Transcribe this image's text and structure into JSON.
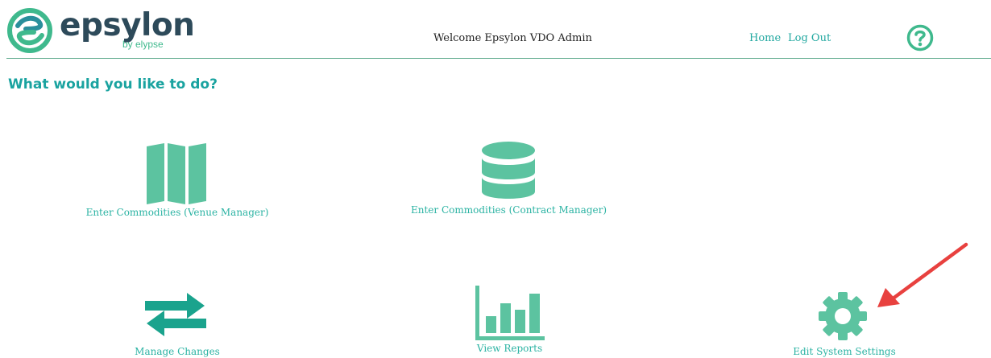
{
  "header": {
    "logo_text": "epsylon",
    "logo_sub": "by elypse",
    "welcome": "Welcome Epsylon VDO Admin",
    "nav": {
      "home": "Home",
      "logout": "Log Out"
    },
    "help_icon": "question-circle-icon"
  },
  "page": {
    "title": "What would you like to do?"
  },
  "tiles": [
    {
      "label": "Enter Commodities (Venue Manager)",
      "icon": "map-icon"
    },
    {
      "label": "Enter Commodities (Contract Manager)",
      "icon": "database-icon"
    },
    {
      "label": "Manage Changes",
      "icon": "exchange-arrows-icon"
    },
    {
      "label": "View Reports",
      "icon": "bar-chart-icon"
    },
    {
      "label": "Edit System Settings",
      "icon": "gear-icon"
    }
  ],
  "annotation": {
    "icon": "red-arrow-icon"
  },
  "colors": {
    "accent": "#5cc3a0",
    "accent_dark": "#1aa3a0",
    "link": "#22a8a0",
    "header_line": "#5aa889",
    "arrow": "#e8413f",
    "logo_text": "#2d4a5a"
  }
}
